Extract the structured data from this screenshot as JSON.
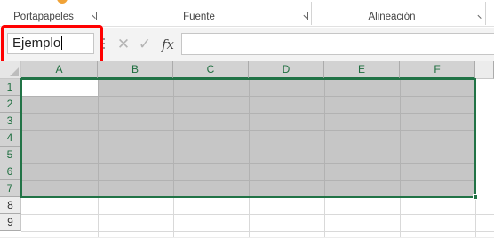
{
  "ribbon": {
    "groups": [
      {
        "label": "Portapapeles"
      },
      {
        "label": "Fuente"
      },
      {
        "label": "Alineación"
      }
    ]
  },
  "formula_bar": {
    "name_box_value": "Ejemplo",
    "cancel_symbol": "✕",
    "enter_symbol": "✓",
    "function_symbol": "fx",
    "formula_value": ""
  },
  "grid": {
    "columns": [
      "A",
      "B",
      "C",
      "D",
      "E",
      "F"
    ],
    "rows": [
      "1",
      "2",
      "3",
      "4",
      "5",
      "6",
      "7",
      "8",
      "9"
    ],
    "selected_range": "A1:F7",
    "active_cell": "A1"
  },
  "colors": {
    "accent": "#217346",
    "highlight": "#ff0000",
    "selection": "#c6c6c6"
  }
}
